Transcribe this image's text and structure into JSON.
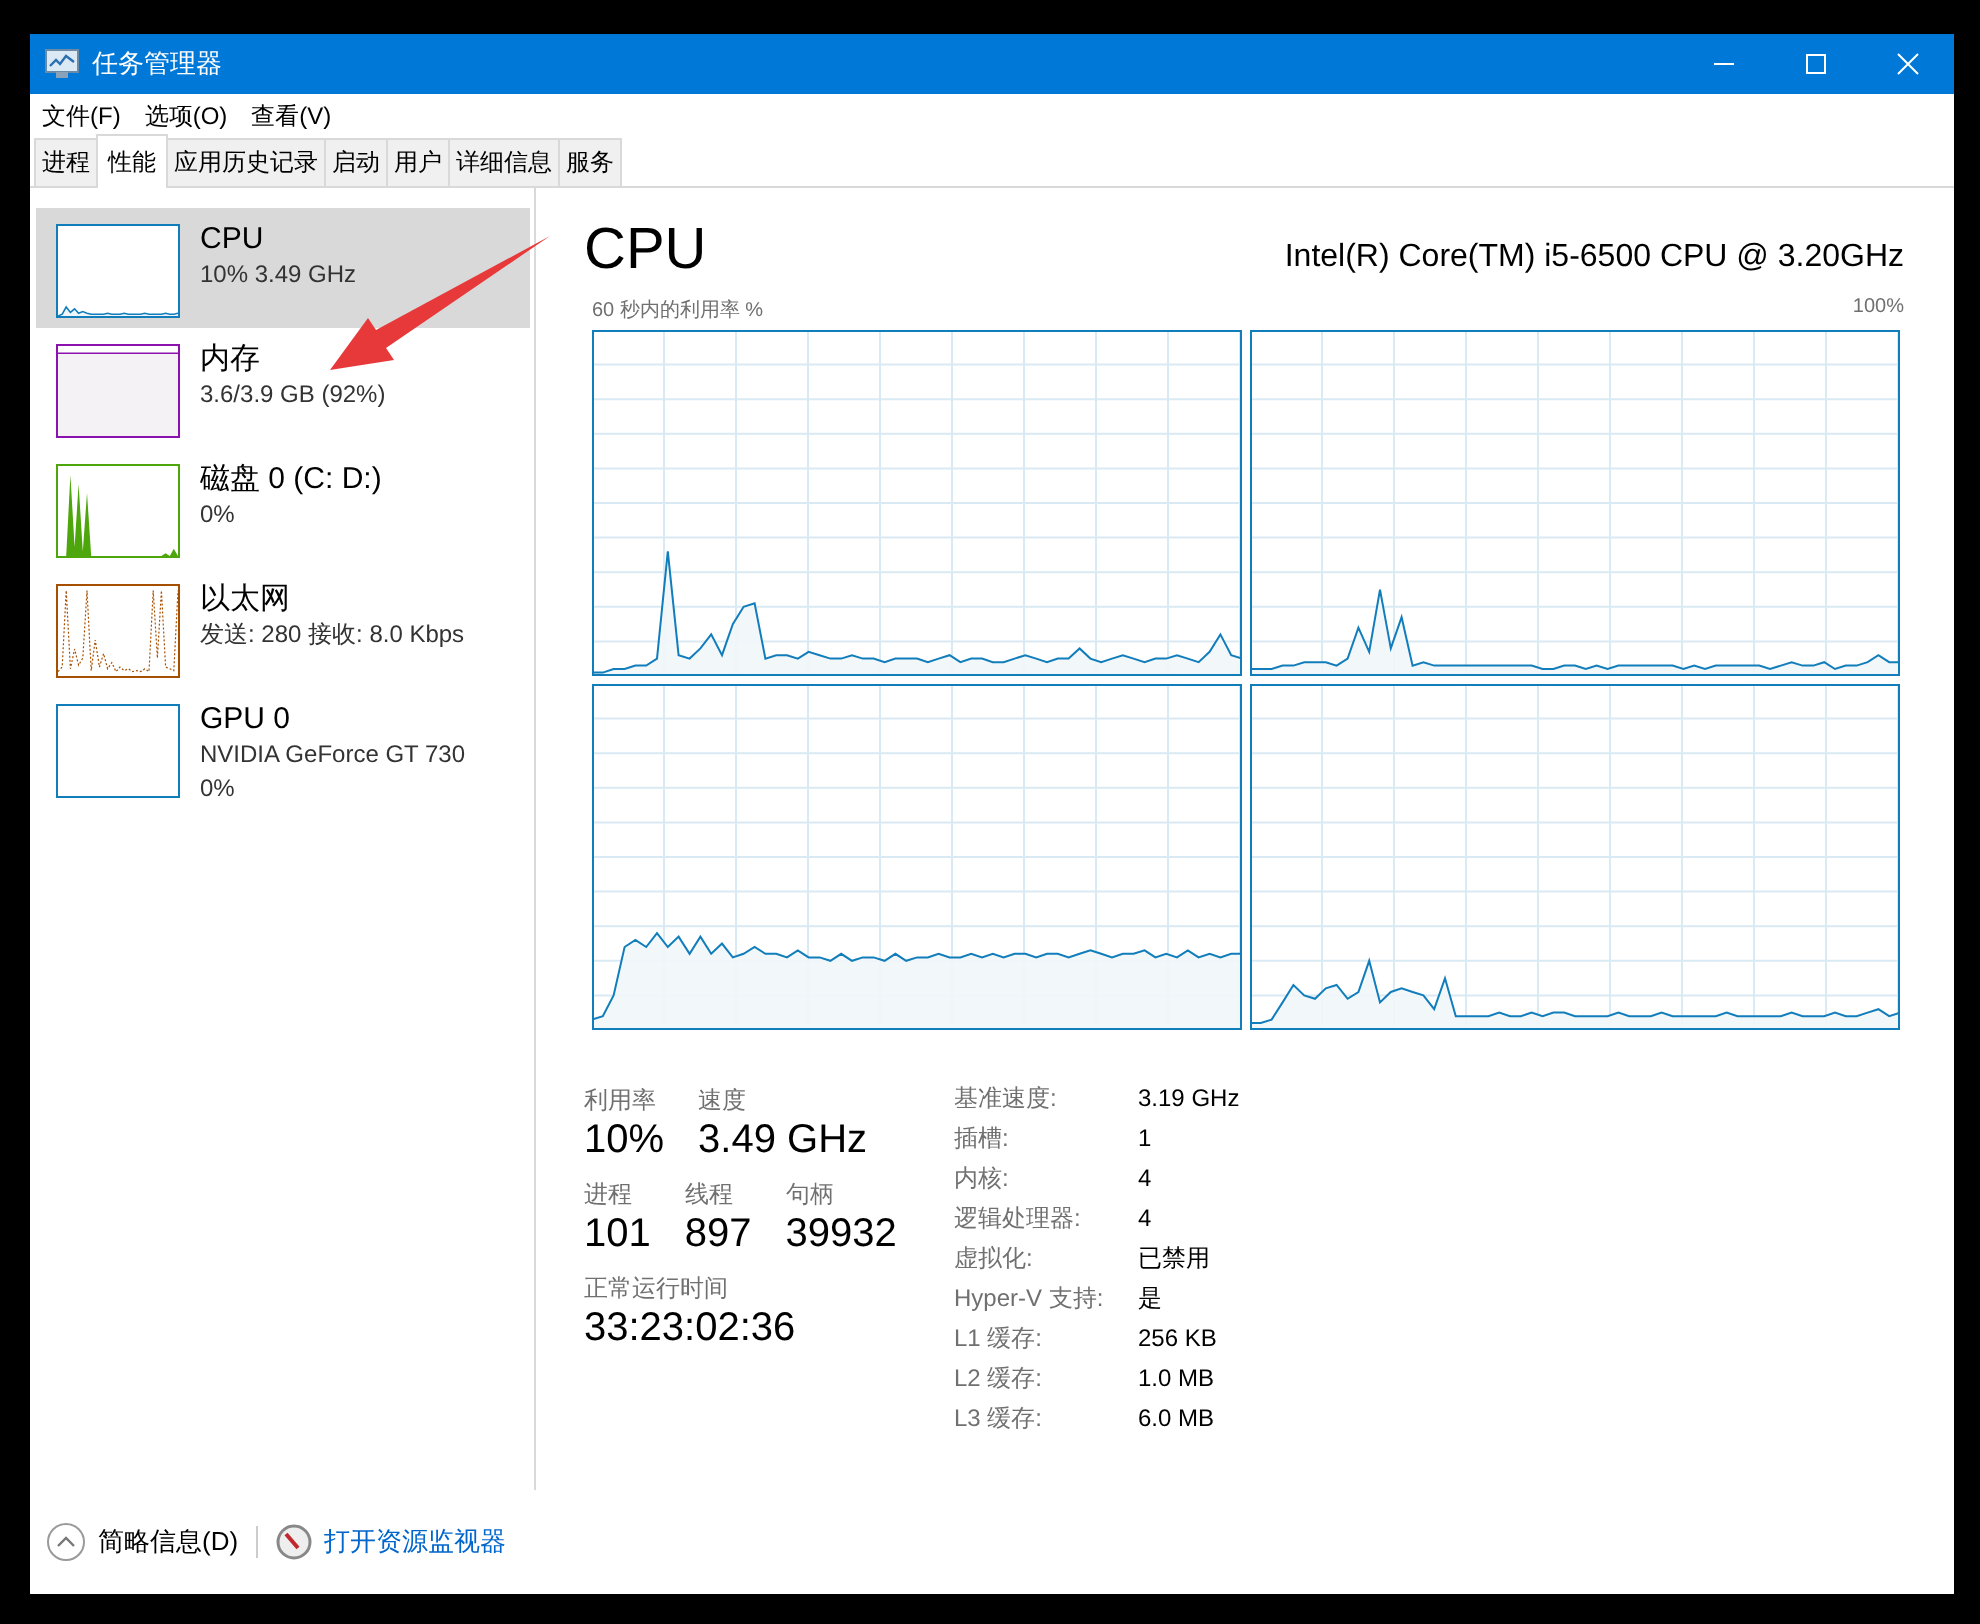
{
  "window": {
    "title": "任务管理器"
  },
  "menu": [
    "文件(F)",
    "选项(O)",
    "查看(V)"
  ],
  "tabs": [
    {
      "label": "进程",
      "selected": false
    },
    {
      "label": "性能",
      "selected": true
    },
    {
      "label": "应用历史记录",
      "selected": false
    },
    {
      "label": "启动",
      "selected": false
    },
    {
      "label": "用户",
      "selected": false
    },
    {
      "label": "详细信息",
      "selected": false
    },
    {
      "label": "服务",
      "selected": false
    }
  ],
  "sidebar": {
    "items": [
      {
        "kind": "cpu",
        "name": "CPU",
        "details": [
          "10% 3.49 GHz"
        ],
        "color": "#117dbb",
        "selected": true
      },
      {
        "kind": "memory",
        "name": "内存",
        "details": [
          "3.6/3.9 GB (92%)"
        ],
        "color": "#8b12ae",
        "selected": false
      },
      {
        "kind": "disk",
        "name": "磁盘 0 (C: D:)",
        "details": [
          "0%"
        ],
        "color": "#4da60c",
        "selected": false
      },
      {
        "kind": "network",
        "name": "以太网",
        "details": [
          "发送: 280 接收: 8.0 Kbps"
        ],
        "color": "#a74f01",
        "selected": false
      },
      {
        "kind": "gpu",
        "name": "GPU 0",
        "details": [
          "NVIDIA GeForce GT 730",
          "0%"
        ],
        "color": "#117dbb",
        "selected": false
      }
    ]
  },
  "main": {
    "title": "CPU",
    "model": "Intel(R) Core(TM) i5-6500 CPU @ 3.20GHz",
    "graph_label": "60 秒内的利用率 %",
    "graph_max": "100%"
  },
  "stats": [
    [
      {
        "label": "利用率",
        "value": "10%"
      },
      {
        "label": "速度",
        "value": "3.49 GHz"
      }
    ],
    [
      {
        "label": "进程",
        "value": "101"
      },
      {
        "label": "线程",
        "value": "897"
      },
      {
        "label": "句柄",
        "value": "39932"
      }
    ],
    [
      {
        "label": "正常运行时间",
        "value": "33:23:02:36"
      }
    ]
  ],
  "specs": [
    {
      "label": "基准速度:",
      "value": "3.19 GHz"
    },
    {
      "label": "插槽:",
      "value": "1"
    },
    {
      "label": "内核:",
      "value": "4"
    },
    {
      "label": "逻辑处理器:",
      "value": "4"
    },
    {
      "label": "虚拟化:",
      "value": "已禁用"
    },
    {
      "label": "Hyper-V 支持:",
      "value": "是"
    },
    {
      "label": "L1 缓存:",
      "value": "256 KB"
    },
    {
      "label": "L2 缓存:",
      "value": "1.0 MB"
    },
    {
      "label": "L3 缓存:",
      "value": "6.0 MB"
    }
  ],
  "footer": {
    "fewer_details": "简略信息(D)",
    "link": "打开资源监视器"
  }
}
